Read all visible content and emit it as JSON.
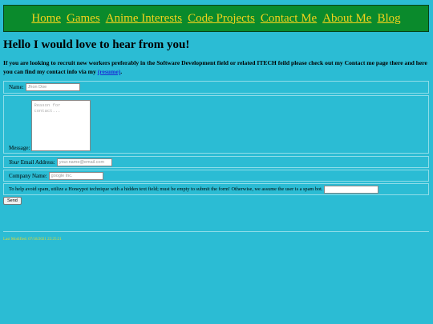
{
  "nav": {
    "items": [
      {
        "label": "Home"
      },
      {
        "label": "Games"
      },
      {
        "label": "Anime Interests"
      },
      {
        "label": "Code Projects"
      },
      {
        "label": "Contact Me"
      },
      {
        "label": "About Me"
      },
      {
        "label": "Blog"
      }
    ]
  },
  "heading": "Hello I would love to hear from you!",
  "intro": {
    "text": "If you are looking to recruit new workers preferably in the Software Development field or related ITECH feild please check out my Contact me page there and here you can find my contact info via my ",
    "link": "(resume)",
    "end": "."
  },
  "form": {
    "name_label": "Name:",
    "name_placeholder": "Jhon Doe",
    "message_label": "Message:",
    "message_placeholder": "Reason for contact...",
    "email_label_italic": "Your",
    "email_label": " Email Address:",
    "email_placeholder": "your.name@email.com",
    "company_label": "Company Name:",
    "company_placeholder": "google Inc.",
    "honeypot_label": "To help avoid spam, utilize a Honeypot technique with a hidden text field; must be empty to submit the form! Otherwise, we assume the user is a spam bot.",
    "send_label": "Send"
  },
  "footer": {
    "last_modified": "Last Modified: 07/18/2021 22:25:21"
  },
  "colors": {
    "background": "#2bbcd4",
    "nav_bg": "#0a8a2c",
    "nav_link": "#f3d31b",
    "link": "#1a2bd6",
    "footer_text": "#e6d830"
  }
}
